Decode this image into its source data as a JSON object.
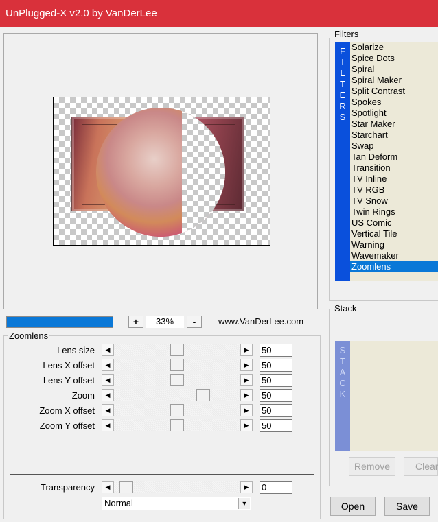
{
  "window": {
    "title": "UnPlugged-X v2.0 by VanDerLee"
  },
  "zoom": {
    "plus": "+",
    "value": "33%",
    "minus": "-",
    "progress": 1.0
  },
  "website": "www.VanDerLee.com",
  "params": {
    "legend": "Zoomlens",
    "sliders": [
      {
        "label": "Lens size",
        "value": "50",
        "position": 0.5
      },
      {
        "label": "Lens X offset",
        "value": "50",
        "position": 0.5
      },
      {
        "label": "Lens Y offset",
        "value": "50",
        "position": 0.5
      },
      {
        "label": "Zoom",
        "value": "50",
        "position": 0.73
      },
      {
        "label": "Zoom X offset",
        "value": "50",
        "position": 0.5
      },
      {
        "label": "Zoom Y offset",
        "value": "50",
        "position": 0.5
      }
    ],
    "transparency": {
      "label": "Transparency",
      "value": "0",
      "position": 0.05
    },
    "mode": "Normal"
  },
  "filters": {
    "legend": "Filters",
    "strip": [
      "F",
      "I",
      "L",
      "T",
      "E",
      "R",
      "S"
    ],
    "items": [
      "Solarize",
      "Spice Dots",
      "Spiral",
      "Spiral Maker",
      "Split Contrast",
      "Spokes",
      "Spotlight",
      "Star Maker",
      "Starchart",
      "Swap",
      "Tan Deform",
      "Transition",
      "TV Inline",
      "TV RGB",
      "TV Snow",
      "Twin Rings",
      "US Comic",
      "Vertical Tile",
      "Warning",
      "Wavemaker",
      "Zoomlens"
    ],
    "selected": "Zoomlens"
  },
  "stack": {
    "legend": "Stack",
    "strip": [
      "S",
      "T",
      "A",
      "C",
      "K"
    ],
    "remove": "Remove",
    "clear": "Clear"
  },
  "buttons": {
    "open": "Open",
    "save": "Save"
  },
  "colors": {
    "titlebar": "#d9313b",
    "accent": "#0a78d7",
    "filters_strip": "#0a50dc",
    "stack_strip": "#7b8fd6",
    "list_bg": "#ece9d8"
  }
}
